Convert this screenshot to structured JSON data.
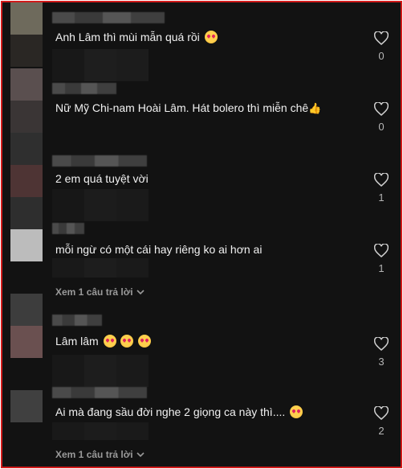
{
  "comments": [
    {
      "text": "Anh Lâm thì mùi mẫn quá rồi",
      "emoji": "smiling-hearts-emoji",
      "likes": "0"
    },
    {
      "text": "Nữ Mỹ Chi-nam Hoài Lâm. Hát bolero thì miễn chê",
      "emoji": "thumbs-up-emoji",
      "likes": "0"
    },
    {
      "text": "2 em quá tuyệt vời",
      "likes": "1"
    },
    {
      "text": "mỗi ngừ có một cái hay riêng ko ai hơn ai",
      "likes": "1",
      "replies": "Xem 1 câu trả lời"
    },
    {
      "text": "Lâm lâm",
      "emoji": "smiling-hearts-emoji",
      "emoji_count": 3,
      "likes": "3"
    },
    {
      "text": "Ai mà đang sầu đời nghe 2 giọng ca này thì....",
      "emoji": "smiling-hearts-emoji",
      "likes": "2",
      "replies": "Xem 1 câu trả lời"
    }
  ],
  "colors": {
    "background": "#121212",
    "border": "#d21b1b",
    "text": "#f1f1f1",
    "muted": "#9a9a9a"
  }
}
